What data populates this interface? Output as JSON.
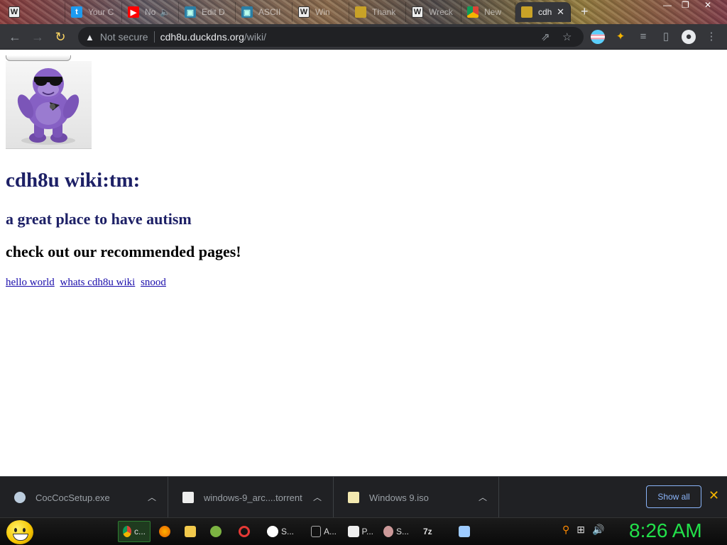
{
  "browser": {
    "tabs": [
      {
        "label": "",
        "icon": "wiki-icon"
      },
      {
        "label": "Your C",
        "icon": "twitter-icon"
      },
      {
        "label": "No",
        "icon": "youtube-icon"
      },
      {
        "label": "Edit D",
        "icon": "edit-icon"
      },
      {
        "label": "ASCII",
        "icon": "edit-icon"
      },
      {
        "label": "Win",
        "icon": "wiki-icon"
      },
      {
        "label": "Thank",
        "icon": "gold-icon"
      },
      {
        "label": "Wreck",
        "icon": "wiki-icon"
      },
      {
        "label": "New",
        "icon": "chrome-icon"
      },
      {
        "label": "cdh",
        "icon": "gold-icon",
        "active": true
      }
    ],
    "new_tab": "+",
    "address": {
      "security": "Not secure",
      "host": "cdh8u.duckdns.org",
      "path": "/wiki/"
    }
  },
  "page": {
    "title": "cdh8u wiki:tm:",
    "tagline": "a great place to have autism",
    "recommended_heading": "check out our recommended pages!",
    "links": [
      "hello world",
      "whats cdh8u wiki",
      "snood"
    ]
  },
  "downloads": {
    "items": [
      "CocCocSetup.exe",
      "windows-9_arc....torrent",
      "Windows 9.iso"
    ],
    "show_all": "Show all"
  },
  "taskbar": {
    "items": [
      {
        "label": "c...",
        "icon": "chrome-icon"
      },
      {
        "label": "",
        "icon": "firefox-icon"
      },
      {
        "label": "",
        "icon": "folder-icon"
      },
      {
        "label": "",
        "icon": "green-app-icon"
      },
      {
        "label": "",
        "icon": "opera-icon"
      },
      {
        "label": "S...",
        "icon": "yandex-icon"
      },
      {
        "label": "A...",
        "icon": "cmd-icon"
      },
      {
        "label": "P...",
        "icon": "paper-icon"
      },
      {
        "label": "S...",
        "icon": "search-app-icon"
      },
      {
        "label": "7z",
        "icon": "sevenzip-icon"
      },
      {
        "label": "",
        "icon": "notepad-icon"
      }
    ],
    "clock": "8:26 AM"
  },
  "colors": {
    "heading_blue": "#1d2066",
    "link_blue": "#1a0dab",
    "clock_green": "#22e04a",
    "chrome_dark": "#35363a"
  }
}
